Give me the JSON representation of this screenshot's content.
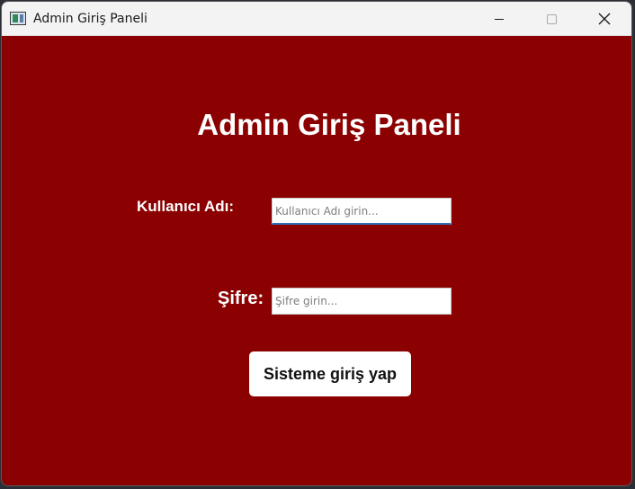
{
  "window": {
    "title": "Admin Giriş Paneli",
    "icon": "java-app-icon",
    "controls": {
      "minimize_icon": "minimize-icon",
      "maximize_icon": "maximize-icon",
      "close_icon": "close-icon"
    }
  },
  "form": {
    "heading": "Admin Giriş Paneli",
    "username": {
      "label": "Kullanıcı Adı:",
      "value": "",
      "placeholder": "Kullanıcı Adı girin..."
    },
    "password": {
      "label": "Şifre:",
      "value": "",
      "placeholder": "Şifre girin..."
    },
    "submit_label": "Sisteme giriş yap"
  },
  "colors": {
    "background": "#8b0000",
    "text": "#ffffff",
    "focus_accent": "#2f6fb8"
  }
}
